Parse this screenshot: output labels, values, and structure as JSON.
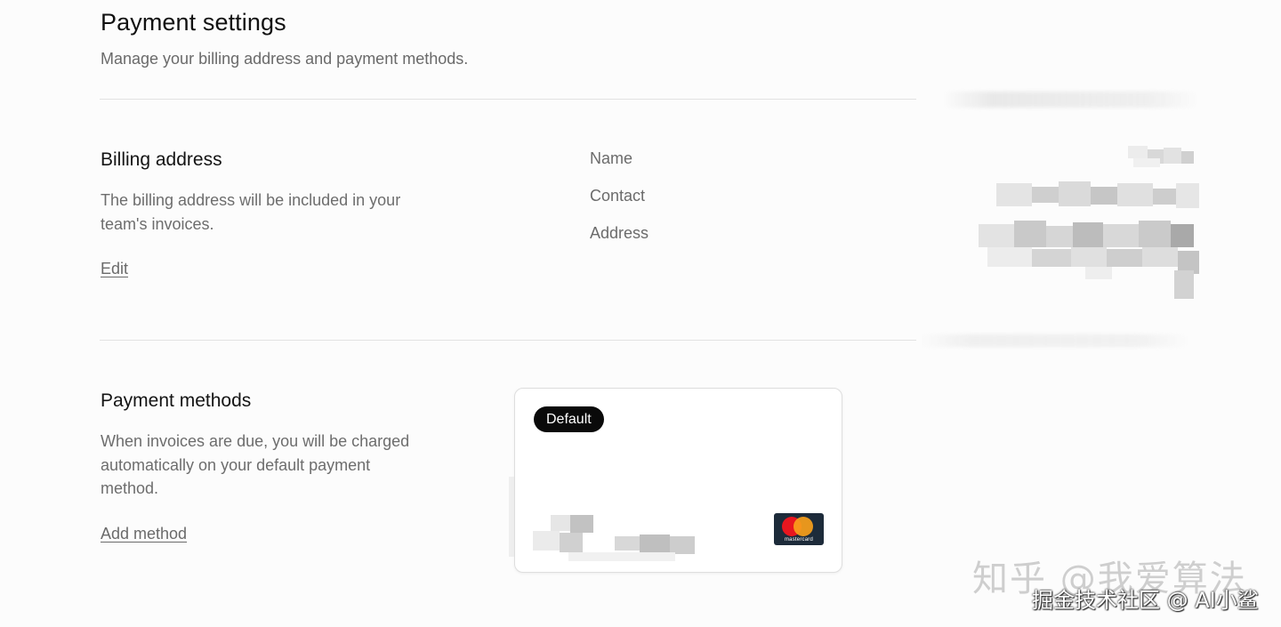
{
  "header": {
    "title": "Payment settings",
    "subtitle": "Manage your billing address and payment methods."
  },
  "billing": {
    "title": "Billing address",
    "description": "The billing address will be included in your team's invoices.",
    "edit_label": "Edit",
    "fields": {
      "name": "Name",
      "contact": "Contact",
      "address": "Address"
    }
  },
  "payment": {
    "title": "Payment methods",
    "description": "When invoices are due, you will be charged automatically on your default payment method.",
    "add_label": "Add method",
    "card": {
      "badge": "Default",
      "brand": "mastercard",
      "brand_icon": "mastercard-logo-icon"
    }
  },
  "watermark": {
    "line1": "知乎 @我爱算法",
    "line2": "掘金技术社区 @ AI小鲨"
  },
  "colors": {
    "badge_bg": "#0a0a0a",
    "mastercard_red": "#e8161f",
    "mastercard_yellow": "#f9a01b",
    "mastercard_bg": "#1d2b3a"
  }
}
